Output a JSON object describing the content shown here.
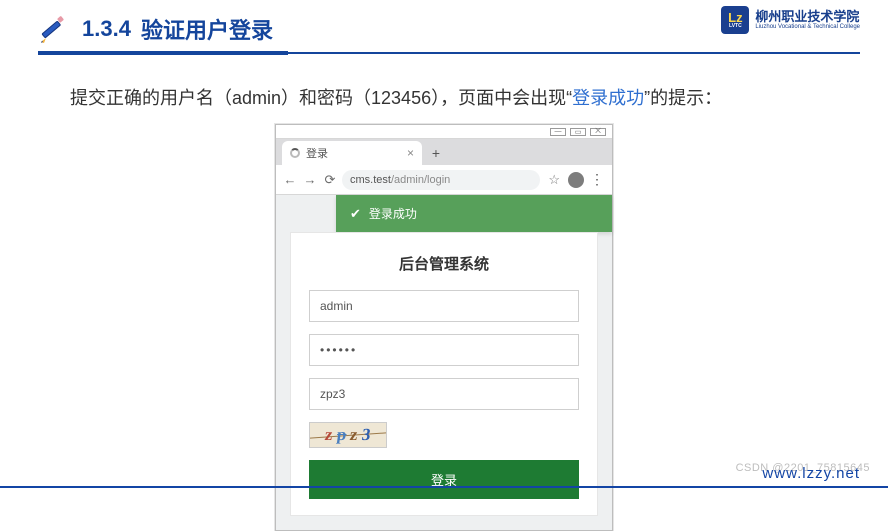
{
  "section": {
    "number": "1.3.4",
    "title": "验证用户登录"
  },
  "logo": {
    "badge": "Lz",
    "badge_sub": "LVTC",
    "cn": "柳州职业技术学院",
    "en": "Liuzhou Vocational & Technical College"
  },
  "intro": {
    "prefix": "提交正确的用户名（admin）和密码（123456），页面中会出现",
    "lq": "“",
    "highlight": "登录成功",
    "rq": "”",
    "suffix": "的提示："
  },
  "browser": {
    "win": {
      "min": "—",
      "max": "▭",
      "close": "⨉"
    },
    "tab": {
      "title": "登录",
      "close": "×",
      "newtab": "+"
    },
    "nav": {
      "back": "←",
      "fwd": "→",
      "reload": "⟳"
    },
    "url": {
      "host": "cms.test",
      "path": "/admin/login"
    },
    "toolbar": {
      "star": "☆",
      "avatar": "●",
      "menu": "⋮"
    }
  },
  "toast": {
    "check": "✔",
    "text": "登录成功"
  },
  "form": {
    "heading": "后台管理系统",
    "username": "admin",
    "password": "••••••",
    "captcha_input": "zpz3",
    "captcha_chars": {
      "c1": "z",
      "c2": "p",
      "c3": "z",
      "c4": "3"
    },
    "submit": "登录"
  },
  "footer": {
    "url": "www.lzzy.net",
    "watermark": "CSDN @2201_75815645"
  }
}
